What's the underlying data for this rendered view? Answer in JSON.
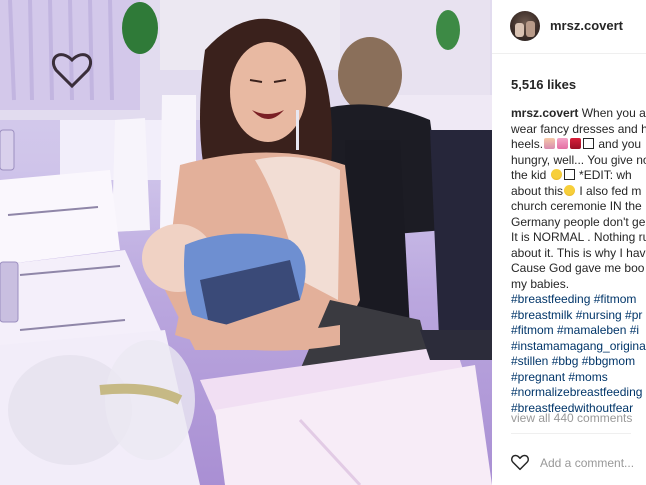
{
  "post": {
    "username": "mrsz.covert",
    "likes": "5,516 likes",
    "caption_lines": [
      [
        {
          "t": "user",
          "v": "mrsz.covert"
        },
        {
          "t": "text",
          "v": " When you ar"
        }
      ],
      [
        {
          "t": "text",
          "v": "wear fancy dresses and h"
        }
      ],
      [
        {
          "t": "text",
          "v": "heels."
        },
        {
          "t": "emoji",
          "v": "woman-emoji"
        },
        {
          "t": "emoji",
          "v": "dress-emoji"
        },
        {
          "t": "emoji",
          "v": "high-heel-emoji"
        },
        {
          "t": "emoji",
          "v": "box-emoji"
        },
        {
          "t": "text",
          "v": " and you"
        }
      ],
      [
        {
          "t": "text",
          "v": "hungry, well... You give no"
        }
      ],
      [
        {
          "t": "text",
          "v": "the kid "
        },
        {
          "t": "emoji",
          "v": "grin-emoji"
        },
        {
          "t": "emoji",
          "v": "box-emoji"
        },
        {
          "t": "text",
          "v": " *EDIT: wh"
        }
      ],
      [
        {
          "t": "text",
          "v": "about this"
        },
        {
          "t": "emoji",
          "v": "laugh-emoji"
        },
        {
          "t": "text",
          "v": " I also fed m"
        }
      ],
      [
        {
          "t": "text",
          "v": "church ceremonie IN the"
        }
      ],
      [
        {
          "t": "text",
          "v": "Germany people don't ge"
        }
      ],
      [
        {
          "t": "text",
          "v": "It is NORMAL . Nothing ru"
        }
      ],
      [
        {
          "t": "text",
          "v": "about it. This is why I hav"
        }
      ],
      [
        {
          "t": "text",
          "v": "Cause God gave me boo"
        }
      ],
      [
        {
          "t": "text",
          "v": "my babies."
        }
      ],
      [
        {
          "t": "tag",
          "v": "#breastfeeding #fitmom"
        }
      ],
      [
        {
          "t": "tag",
          "v": "#breastmilk #nursing #pr"
        }
      ],
      [
        {
          "t": "tag",
          "v": "#fitmom #mamaleben #i"
        }
      ],
      [
        {
          "t": "tag",
          "v": "#instamamagang_origina"
        }
      ],
      [
        {
          "t": "tag",
          "v": "#stillen #bbg #bbgmom"
        }
      ],
      [
        {
          "t": "tag",
          "v": "#pregnant #moms"
        }
      ],
      [
        {
          "t": "tag",
          "v": "#normalizebreastfeeding"
        }
      ],
      [
        {
          "t": "tag",
          "v": "#breastfeedwithoutfear"
        }
      ]
    ],
    "view_comments": "view all 440 comments",
    "add_comment_placeholder": "Add a comment..."
  },
  "colors": {
    "hashtag": "#003569",
    "muted": "#999999",
    "text": "#262626",
    "photo_tint": "#c8b8e8"
  }
}
